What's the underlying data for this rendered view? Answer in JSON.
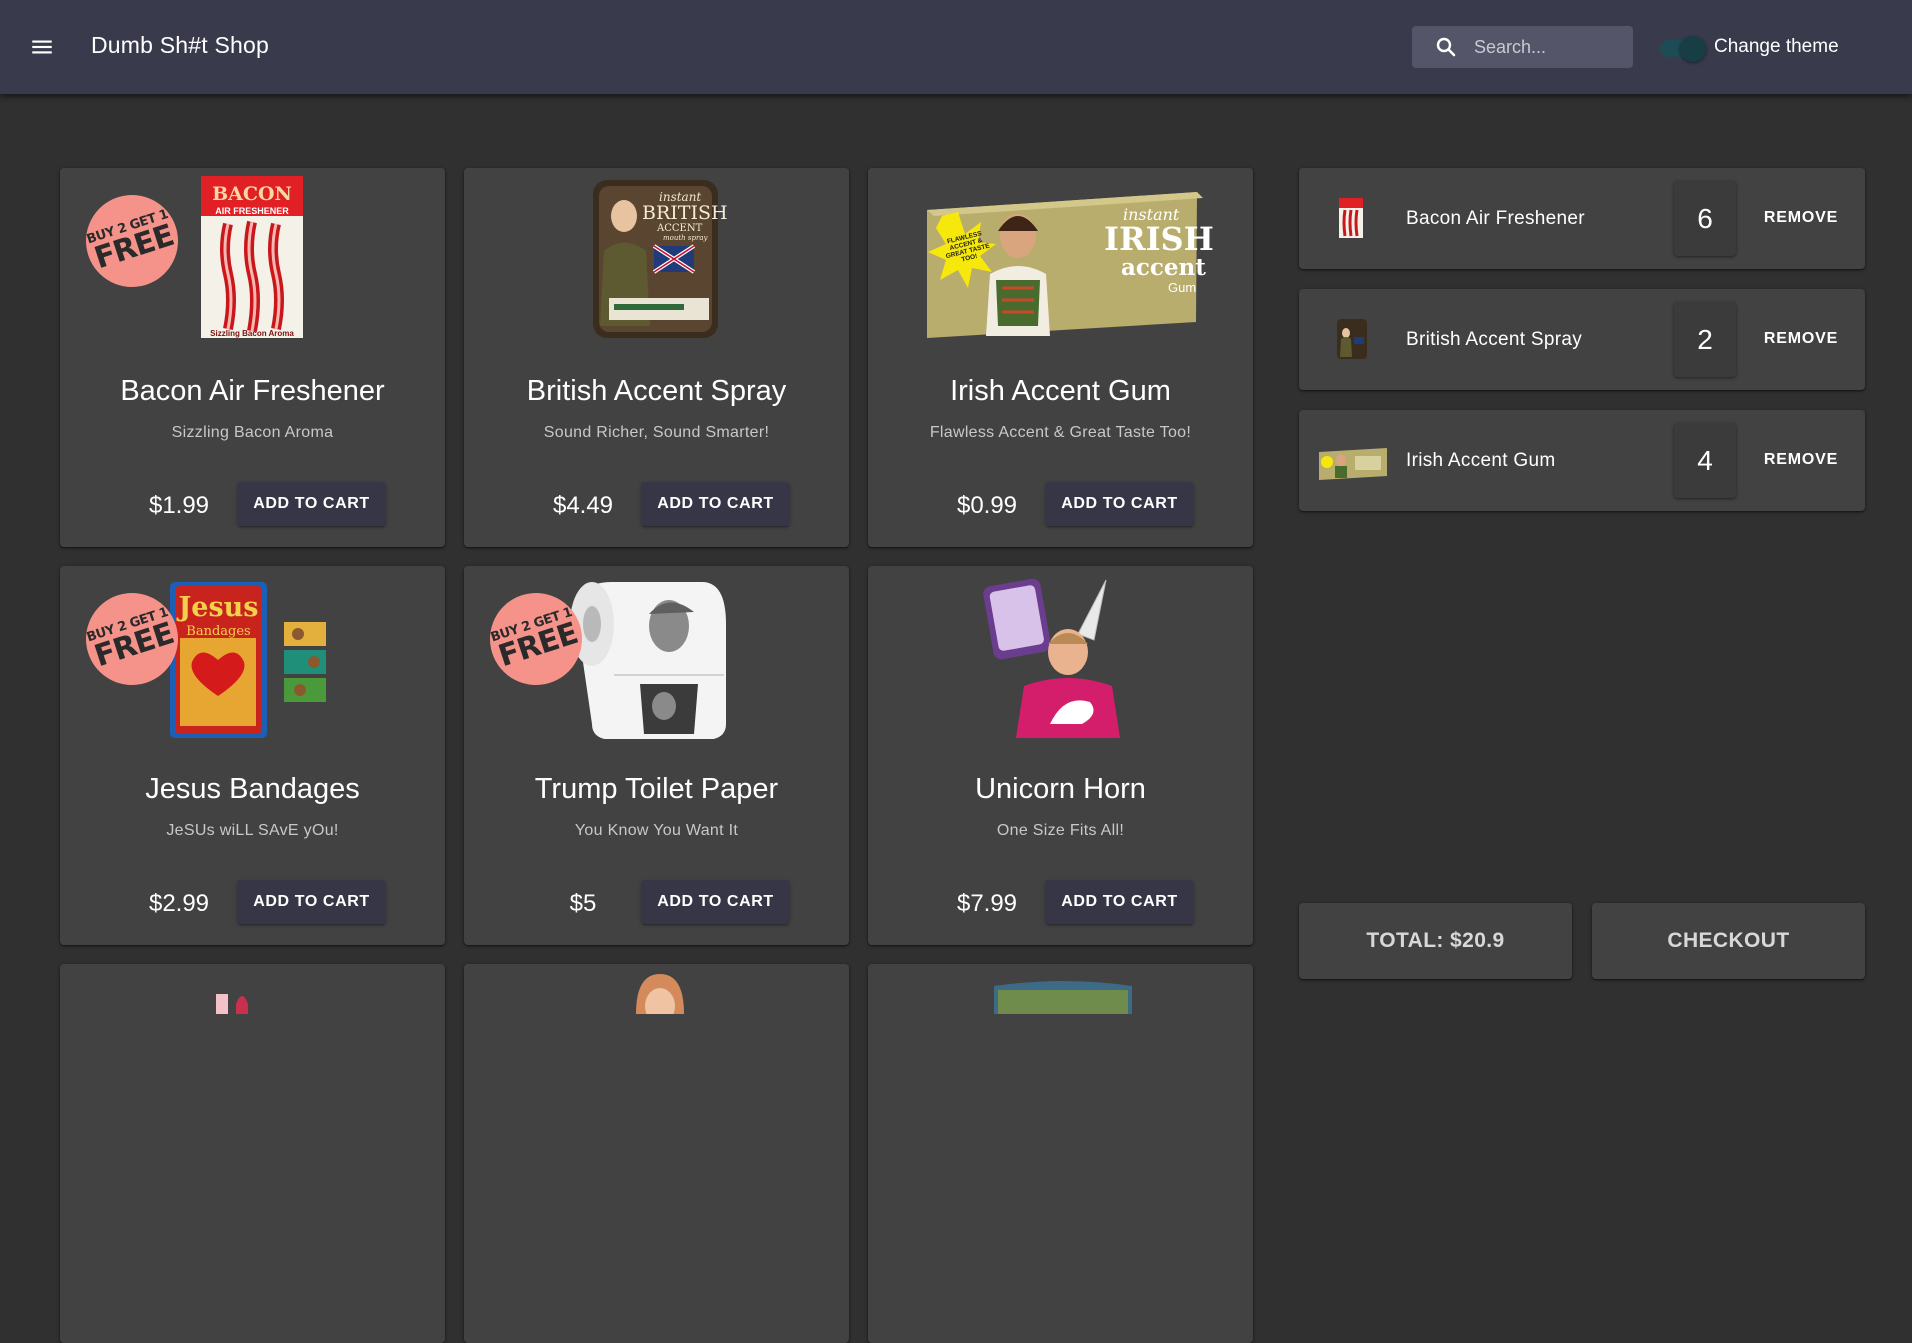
{
  "header": {
    "title": "Dumb Sh#t Shop",
    "search_placeholder": "Search...",
    "theme_label": "Change theme"
  },
  "promo": {
    "line1": "BUY 2 GET 1",
    "line2": "FREE"
  },
  "products": [
    {
      "name": "Bacon Air Freshener",
      "desc": "Sizzling Bacon Aroma",
      "price": "$1.99",
      "button": "ADD TO CART"
    },
    {
      "name": "British Accent Spray",
      "desc": "Sound Richer, Sound Smarter!",
      "price": "$4.49",
      "button": "ADD TO CART"
    },
    {
      "name": "Irish Accent Gum",
      "desc": "Flawless Accent & Great Taste Too!",
      "price": "$0.99",
      "button": "ADD TO CART"
    },
    {
      "name": "Jesus Bandages",
      "desc": "JeSUs wiLL SAvE yOu!",
      "price": "$2.99",
      "button": "ADD TO CART"
    },
    {
      "name": "Trump Toilet Paper",
      "desc": "You Know You Want It",
      "price": "$5",
      "button": "ADD TO CART"
    },
    {
      "name": "Unicorn Horn",
      "desc": "One Size Fits All!",
      "price": "$7.99",
      "button": "ADD TO CART"
    }
  ],
  "package_text": {
    "bacon_top": "BACON",
    "bacon_sub": "AIR FRESHENER",
    "bacon_bottom": "Sizzling Bacon Aroma",
    "british_1": "instant",
    "british_2": "BRITISH",
    "british_3": "ACCENT",
    "british_4": "mouth spray",
    "irish_1": "instant",
    "irish_2": "IRISH",
    "irish_3": "accent",
    "irish_4": "Gum",
    "irish_badge": "FLAWLESS ACCENT & GREAT TASTE TOO!",
    "jesus_1": "Jesus",
    "jesus_2": "Bandages"
  },
  "cart": {
    "items": [
      {
        "name": "Bacon Air Freshener",
        "qty": "6",
        "remove": "REMOVE"
      },
      {
        "name": "British Accent Spray",
        "qty": "2",
        "remove": "REMOVE"
      },
      {
        "name": "Irish Accent Gum",
        "qty": "4",
        "remove": "REMOVE"
      }
    ],
    "total": "TOTAL: $20.9",
    "checkout": "CHECKOUT"
  },
  "colors": {
    "appbar": "#3a3a4d",
    "background": "#303030",
    "card": "#424242",
    "button": "#363647",
    "promo": "#f5938a"
  }
}
